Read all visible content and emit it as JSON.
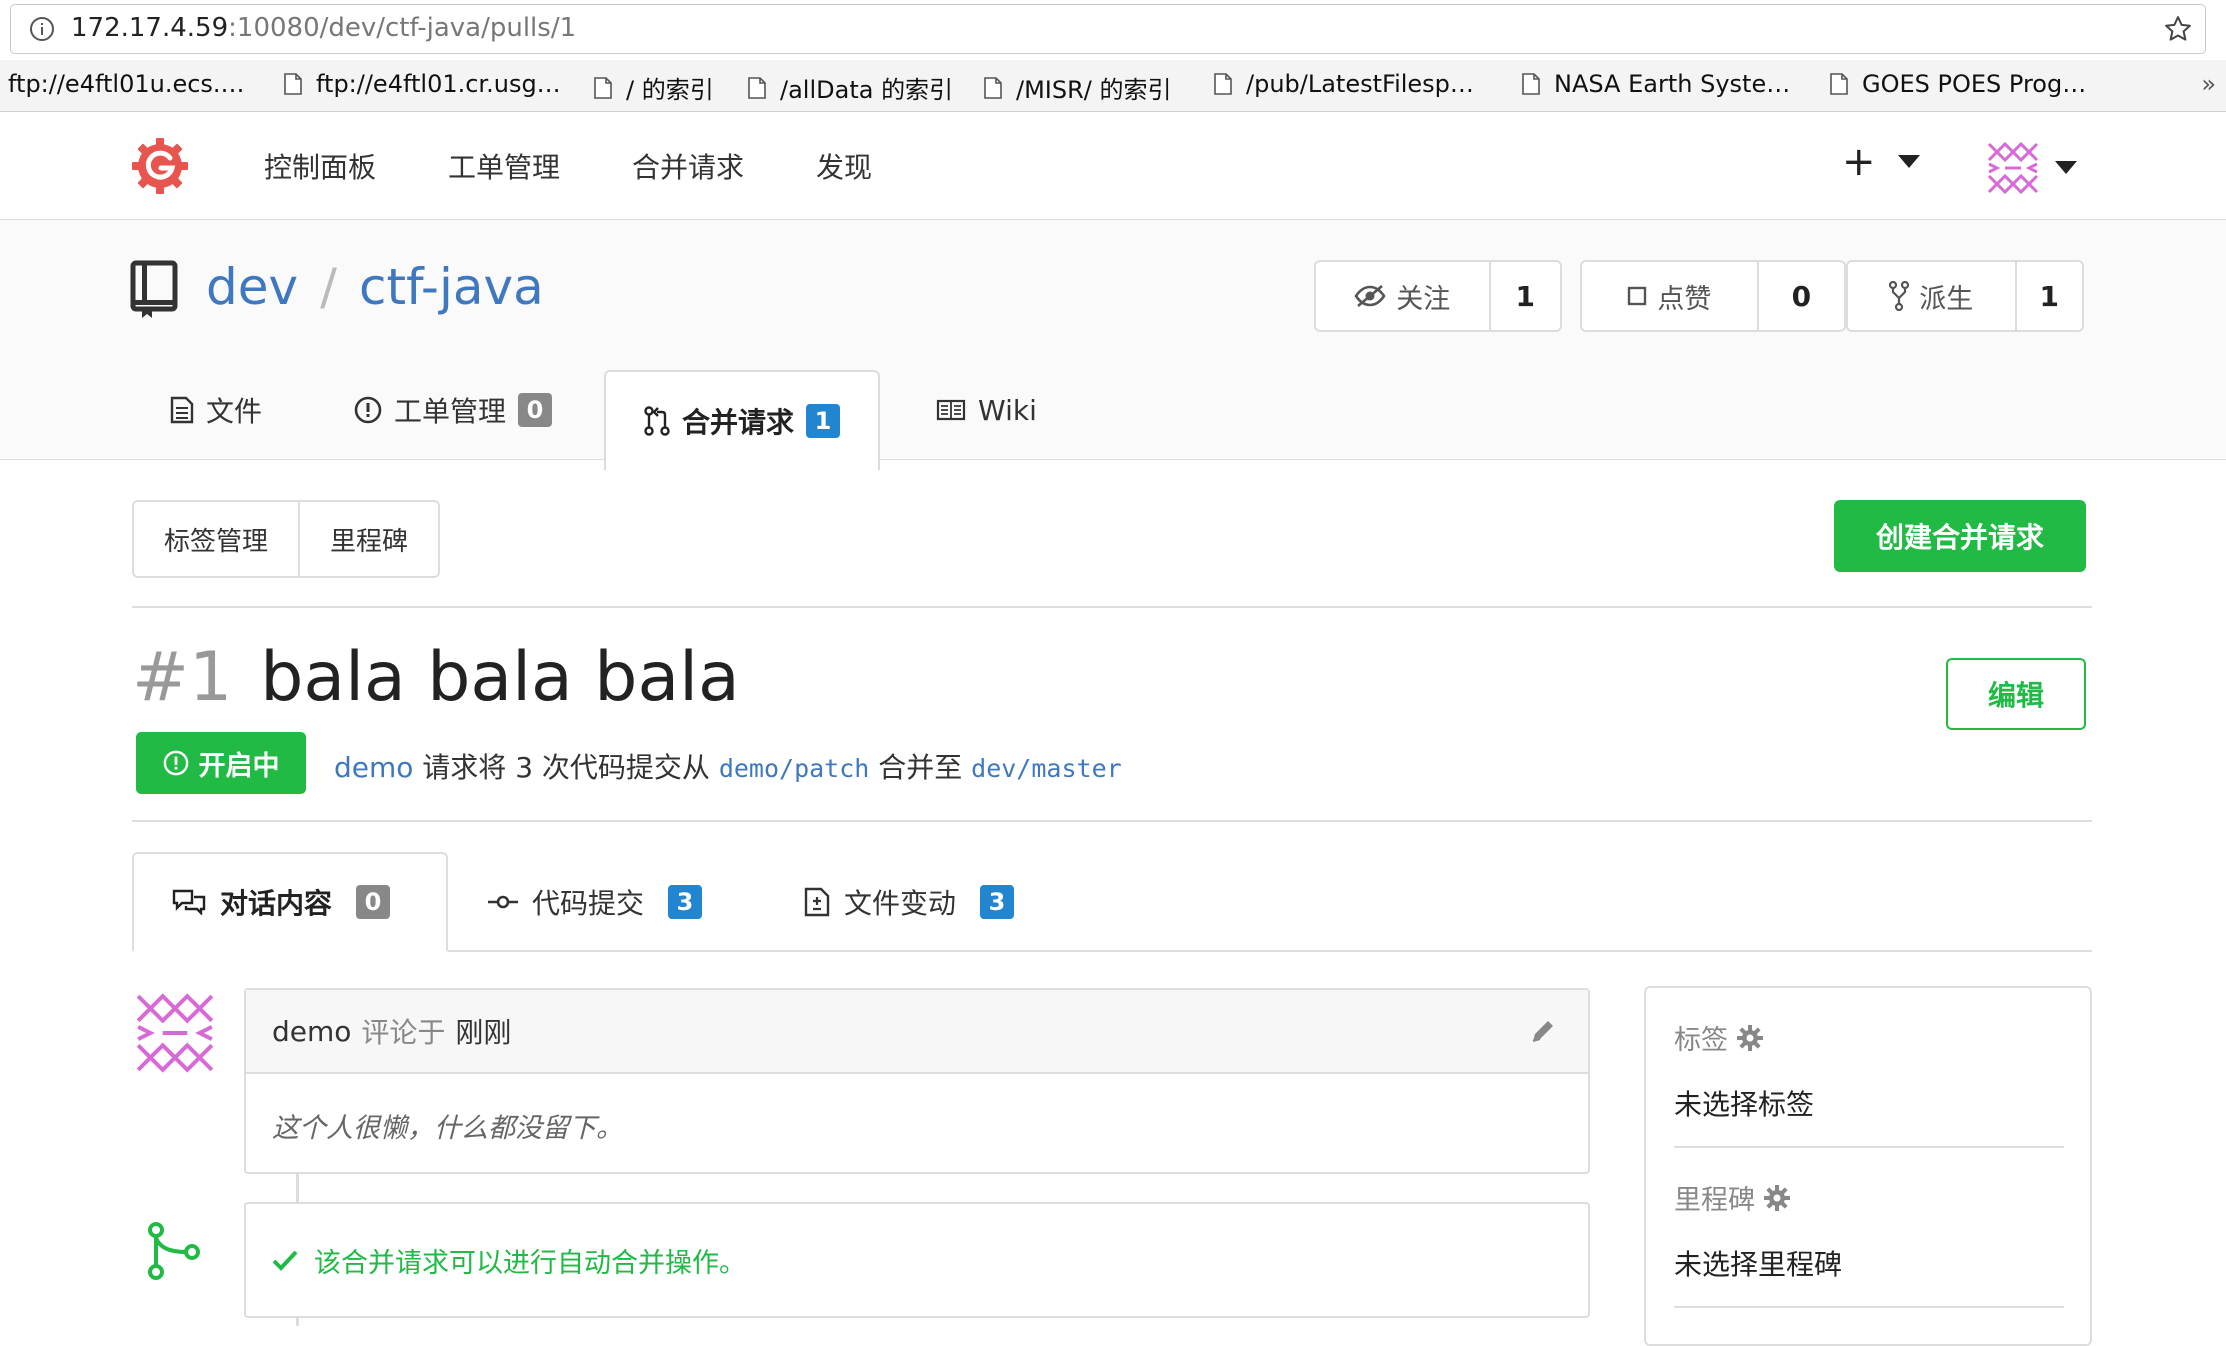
{
  "browser": {
    "url_host": "172.17.4.59",
    "url_rest": ":10080/dev/ctf-java/pulls/1",
    "bookmarks": [
      "ftp://e4ftl01u.ecs.…",
      "ftp://e4ftl01.cr.usg…",
      "/ 的索引",
      "/allData 的索引",
      "/MISR/ 的索引",
      "/pub/LatestFilesp…",
      "NASA Earth Syste…",
      "GOES POES Prog…"
    ],
    "more": "»"
  },
  "nav": {
    "items": [
      "控制面板",
      "工单管理",
      "合并请求",
      "发现"
    ],
    "plus": "+"
  },
  "repo": {
    "owner": "dev",
    "separator": "/",
    "name": "ctf-java",
    "watch": {
      "label": "关注",
      "count": "1"
    },
    "star": {
      "label": "点赞",
      "count": "0"
    },
    "fork": {
      "label": "派生",
      "count": "1"
    },
    "tabs": {
      "files": "文件",
      "issues": "工单管理",
      "issues_count": "0",
      "pulls": "合并请求",
      "pulls_count": "1",
      "wiki": "Wiki"
    }
  },
  "toolbar": {
    "labels": "标签管理",
    "milestones": "里程碑",
    "create": "创建合并请求"
  },
  "pr": {
    "number": "#1",
    "title": "bala bala bala",
    "edit": "编辑",
    "status": "开启中",
    "author": "demo",
    "desc_1": " 请求将 3 次代码提交从 ",
    "head": "demo/patch",
    "desc_2": " 合并至 ",
    "base": "dev/master",
    "tabs": {
      "conversation": "对话内容",
      "conversation_count": "0",
      "commits": "代码提交",
      "commits_count": "3",
      "files": "文件变动",
      "files_count": "3"
    }
  },
  "comment": {
    "author": "demo",
    "verb": "评论于",
    "time": "刚刚",
    "body": "这个人很懒，什么都没留下。"
  },
  "merge": {
    "message": "该合并请求可以进行自动合并操作。"
  },
  "sidebar": {
    "labels_title": "标签",
    "labels_value": "未选择标签",
    "milestone_title": "里程碑",
    "milestone_value": "未选择里程碑"
  },
  "colors": {
    "green": "#21ba45",
    "blue_link": "#4078c0",
    "badge_blue": "#2185d0",
    "badge_grey": "#888888",
    "logo_red": "#e8554e",
    "avatar_pink": "#d86ad8"
  }
}
